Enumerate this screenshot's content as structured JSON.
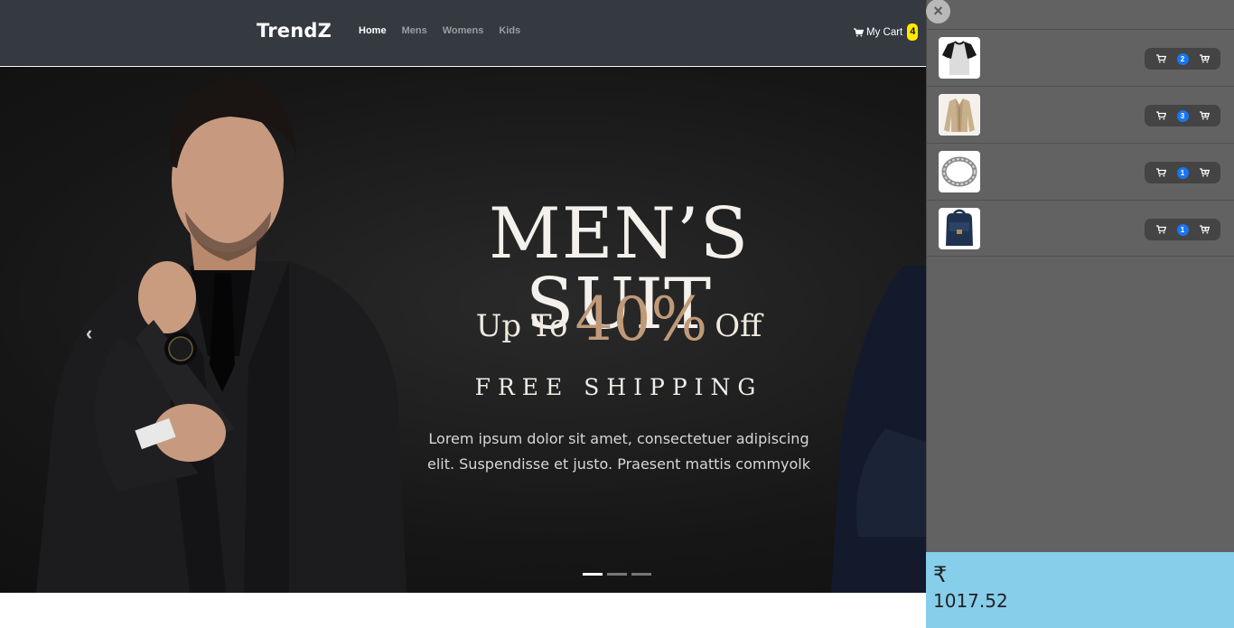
{
  "navbar": {
    "brand": "TrendZ",
    "links": [
      {
        "label": "Home",
        "active": true
      },
      {
        "label": "Mens",
        "active": false
      },
      {
        "label": "Womens",
        "active": false
      },
      {
        "label": "Kids",
        "active": false
      }
    ],
    "cart_label": "My Cart",
    "cart_count": "4"
  },
  "hero": {
    "title": "MEN’S SUIT",
    "offer_prefix": "Up To",
    "offer_value": "40%",
    "offer_suffix": "Off",
    "shipping": "FREE SHIPPING",
    "text_line1": "Lorem ipsum dolor sit amet, consectetuer adipiscing",
    "text_line2": "elit. Suspendisse et justo. Praesent mattis commyolk",
    "slide_count": 3,
    "active_slide": 1
  },
  "sidebar": {
    "close_label": "×",
    "items": [
      {
        "qty": "2",
        "icon": "raglan-tshirt"
      },
      {
        "qty": "3",
        "icon": "beige-jacket"
      },
      {
        "qty": "1",
        "icon": "silver-bracelet"
      },
      {
        "qty": "1",
        "icon": "navy-backpack"
      }
    ],
    "currency_symbol": "₹",
    "total": "1017.52"
  },
  "colors": {
    "navbar": "#343a40",
    "sidebar": "#626262",
    "total_bg": "#87ceeb",
    "badge_yellow": "#ffeb00",
    "qty_badge": "#1876f2",
    "accent_gold": "#c09a78"
  }
}
